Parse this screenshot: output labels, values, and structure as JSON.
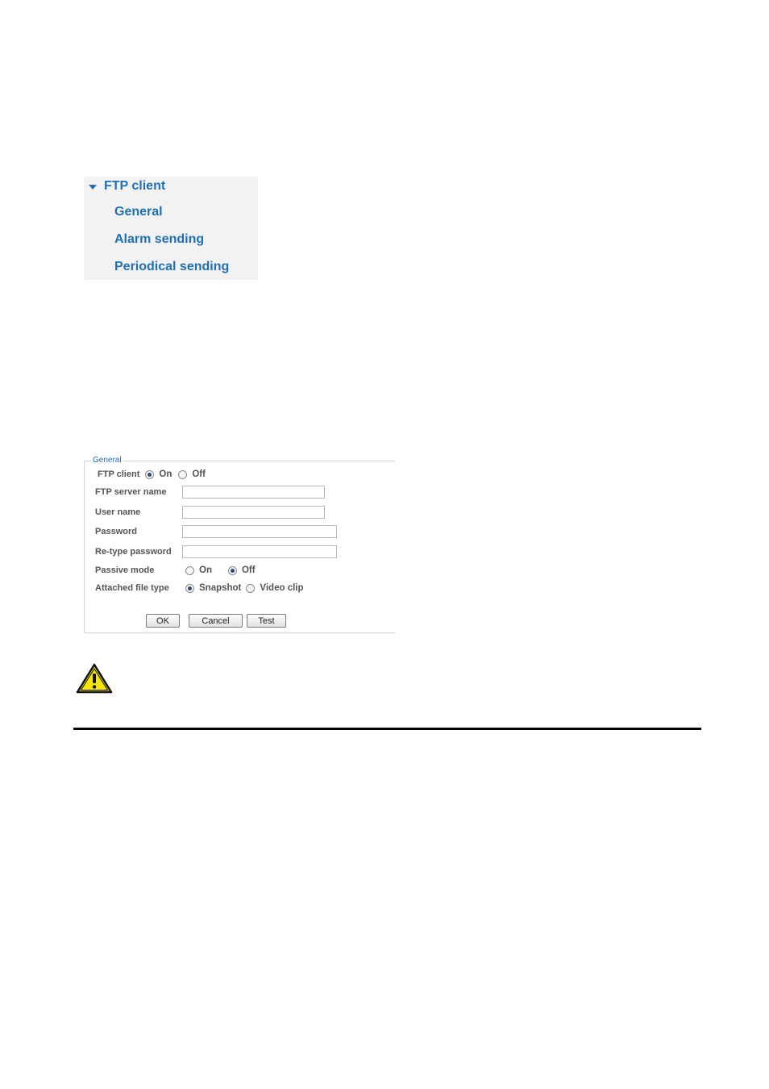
{
  "menu": {
    "title": "FTP client",
    "items": [
      {
        "label": "General"
      },
      {
        "label": "Alarm sending"
      },
      {
        "label": "Periodical sending"
      }
    ]
  },
  "form": {
    "legend": "General",
    "ftp_client": {
      "label": "FTP client",
      "on": "On",
      "off": "Off",
      "selected": "On"
    },
    "server_name": {
      "label": "FTP server name",
      "value": ""
    },
    "user_name": {
      "label": "User name",
      "value": ""
    },
    "password": {
      "label": "Password",
      "value": ""
    },
    "retype_password": {
      "label": "Re-type password",
      "value": ""
    },
    "passive_mode": {
      "label": "Passive mode",
      "on": "On",
      "off": "Off",
      "selected": "Off"
    },
    "file_type": {
      "label": "Attached file type",
      "snapshot": "Snapshot",
      "video": "Video clip",
      "selected": "Snapshot"
    },
    "buttons": {
      "ok": "OK",
      "cancel": "Cancel",
      "test": "Test"
    }
  },
  "colors": {
    "link": "#1f6fb7",
    "warning_fill": "#f7e600",
    "radio_dot": "#274a7a"
  },
  "icons": {
    "warning": "warning-triangle-icon",
    "caret": "caret-down-icon"
  }
}
